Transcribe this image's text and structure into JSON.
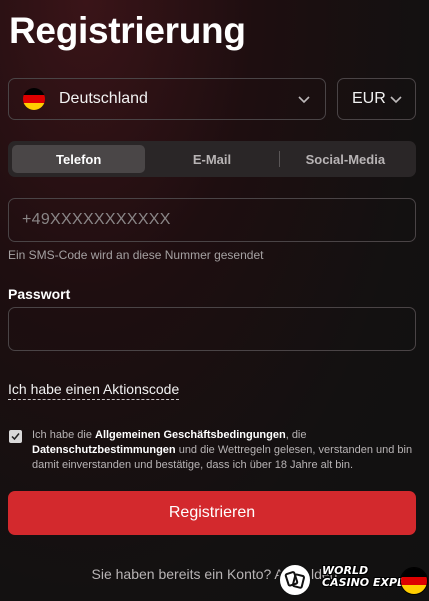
{
  "page": {
    "title": "Registrierung"
  },
  "country": {
    "name": "Deutschland",
    "flag_icon": "germany-flag-icon"
  },
  "currency": {
    "value": "EUR"
  },
  "tabs": [
    {
      "label": "Telefon",
      "active": true
    },
    {
      "label": "E-Mail",
      "active": false
    },
    {
      "label": "Social-Media",
      "active": false
    }
  ],
  "phone": {
    "placeholder": "+49XXXXXXXXXXX",
    "hint": "Ein SMS-Code wird an diese Nummer gesendet"
  },
  "password": {
    "label": "Passwort",
    "value": ""
  },
  "promo": {
    "label": "Ich habe einen Aktionscode"
  },
  "terms": {
    "checked": true,
    "part1": "Ich habe die ",
    "link1": "Allgemeinen Geschäftsbedingungen",
    "part2": ", die ",
    "link2": "Datenschutzbestimmungen",
    "part3": " und die Wettregeln gelesen, verstanden und bin damit einverstanden und bestätige, dass ich über 18 Jahre alt bin."
  },
  "submit": {
    "label": "Registrieren"
  },
  "login": {
    "text": "Sie haben bereits ein Konto? Anmelden"
  },
  "watermark": {
    "line1": "WORLD",
    "line2": "CASINO EXPERT"
  },
  "colors": {
    "accent": "#d3292d",
    "background": "#131111",
    "border": "#4a4446"
  }
}
